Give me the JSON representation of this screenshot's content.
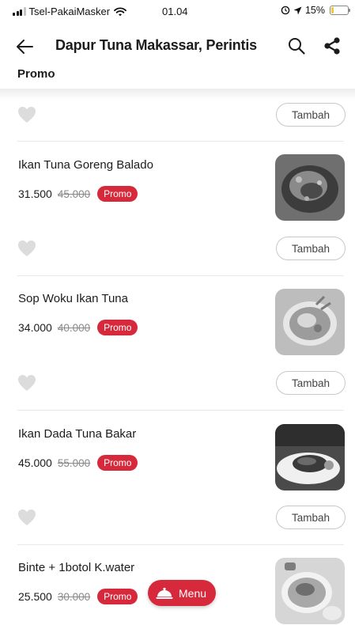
{
  "status_bar": {
    "carrier": "Tsel-PakaiMasker",
    "time": "01.04",
    "battery": "15%",
    "battery_level": 0.15
  },
  "header": {
    "title": "Dapur Tuna Makassar, Perintis"
  },
  "section": {
    "label": "Promo"
  },
  "add_label": "Tambah",
  "items": [
    {
      "name": "Ikan Tuna Goreng Balado",
      "price": "31.500",
      "old_price": "45.000",
      "badge": "Promo",
      "thumbnail_icon": "tuna-balado-photo"
    },
    {
      "name": "Sop Woku Ikan Tuna",
      "price": "34.000",
      "old_price": "40.000",
      "badge": "Promo",
      "thumbnail_icon": "tuna-soup-photo"
    },
    {
      "name": "Ikan Dada Tuna Bakar",
      "price": "45.000",
      "old_price": "55.000",
      "badge": "Promo",
      "thumbnail_icon": "grilled-tuna-photo"
    },
    {
      "name": "Binte + 1botol K.water",
      "price": "25.500",
      "old_price": "30.000",
      "badge": "Promo",
      "thumbnail_icon": "binte-photo"
    }
  ],
  "fab": {
    "label": "Menu",
    "icon": "cloche-icon"
  },
  "colors": {
    "accent": "#d62a3c",
    "battery": "#f2cc2a"
  }
}
